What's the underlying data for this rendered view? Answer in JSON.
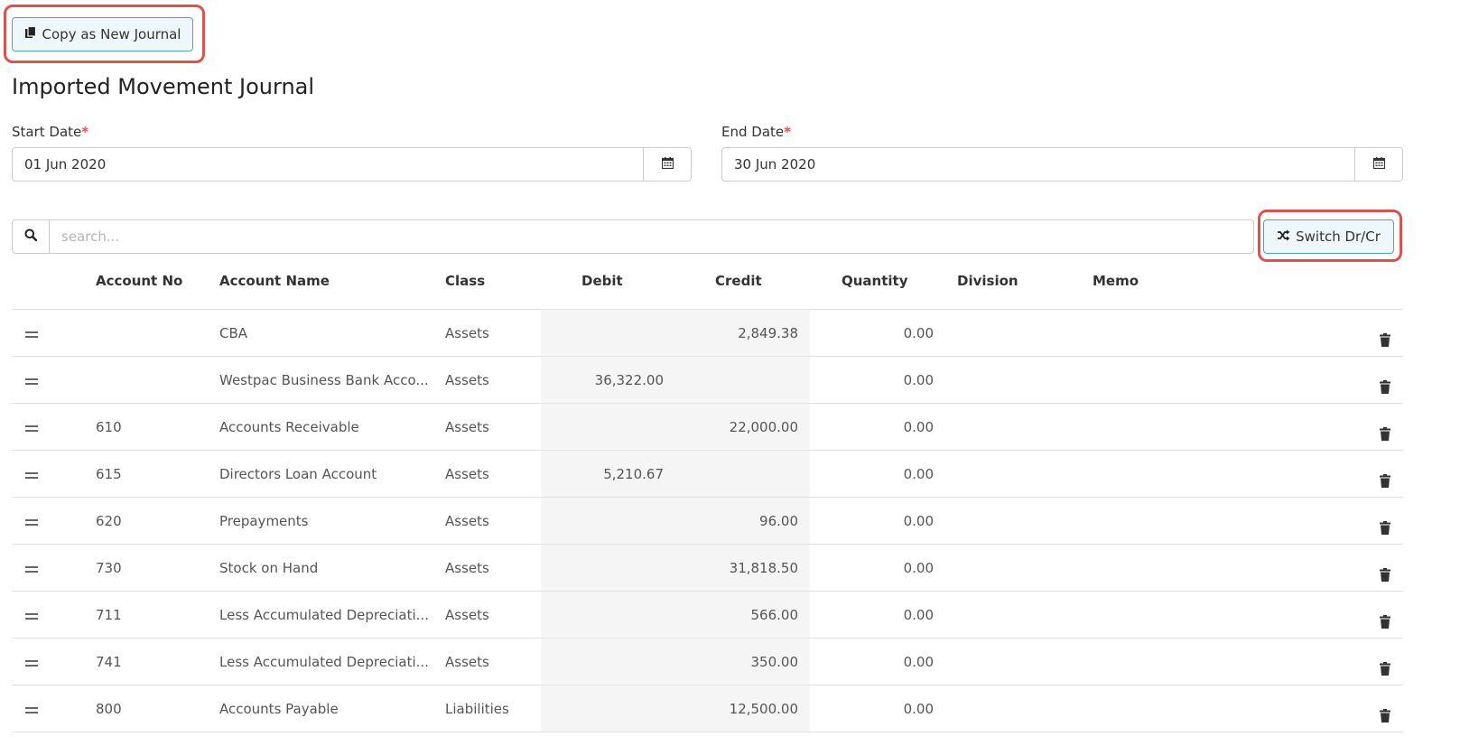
{
  "toolbar": {
    "copy_label": "Copy as New Journal",
    "switch_label": "Switch Dr/Cr"
  },
  "page": {
    "title": "Imported Movement Journal"
  },
  "dates": {
    "start_label": "Start Date",
    "start_value": "01 Jun 2020",
    "end_label": "End Date",
    "end_value": "30 Jun 2020",
    "required_mark": "*"
  },
  "search": {
    "placeholder": "search..."
  },
  "table": {
    "headers": {
      "account_no": "Account No",
      "account_name": "Account Name",
      "class": "Class",
      "debit": "Debit",
      "credit": "Credit",
      "quantity": "Quantity",
      "division": "Division",
      "memo": "Memo"
    },
    "rows": [
      {
        "account_no": "",
        "account_name": "CBA",
        "class": "Assets",
        "debit": "",
        "credit": "2,849.38",
        "quantity": "0.00"
      },
      {
        "account_no": "",
        "account_name": "Westpac Business Bank Acco...",
        "class": "Assets",
        "debit": "36,322.00",
        "credit": "",
        "quantity": "0.00"
      },
      {
        "account_no": "610",
        "account_name": "Accounts Receivable",
        "class": "Assets",
        "debit": "",
        "credit": "22,000.00",
        "quantity": "0.00"
      },
      {
        "account_no": "615",
        "account_name": "Directors Loan Account",
        "class": "Assets",
        "debit": "5,210.67",
        "credit": "",
        "quantity": "0.00"
      },
      {
        "account_no": "620",
        "account_name": "Prepayments",
        "class": "Assets",
        "debit": "",
        "credit": "96.00",
        "quantity": "0.00"
      },
      {
        "account_no": "730",
        "account_name": "Stock on Hand",
        "class": "Assets",
        "debit": "",
        "credit": "31,818.50",
        "quantity": "0.00"
      },
      {
        "account_no": "711",
        "account_name": "Less Accumulated Depreciati...",
        "class": "Assets",
        "debit": "",
        "credit": "566.00",
        "quantity": "0.00"
      },
      {
        "account_no": "741",
        "account_name": "Less Accumulated Depreciati...",
        "class": "Assets",
        "debit": "",
        "credit": "350.00",
        "quantity": "0.00"
      },
      {
        "account_no": "800",
        "account_name": "Accounts Payable",
        "class": "Liabilities",
        "debit": "",
        "credit": "12,500.00",
        "quantity": "0.00"
      }
    ]
  },
  "colors": {
    "highlight": "#d9534f",
    "button_border": "#4ba3cc",
    "button_bg": "#eef8fc",
    "debit_column_bg": "#f5f5f5"
  },
  "icons": {
    "copy": "copy-icon",
    "shuffle": "shuffle-icon",
    "calendar": "calendar-icon",
    "search": "search-icon",
    "drag": "drag-handle-icon",
    "trash": "trash-icon"
  }
}
